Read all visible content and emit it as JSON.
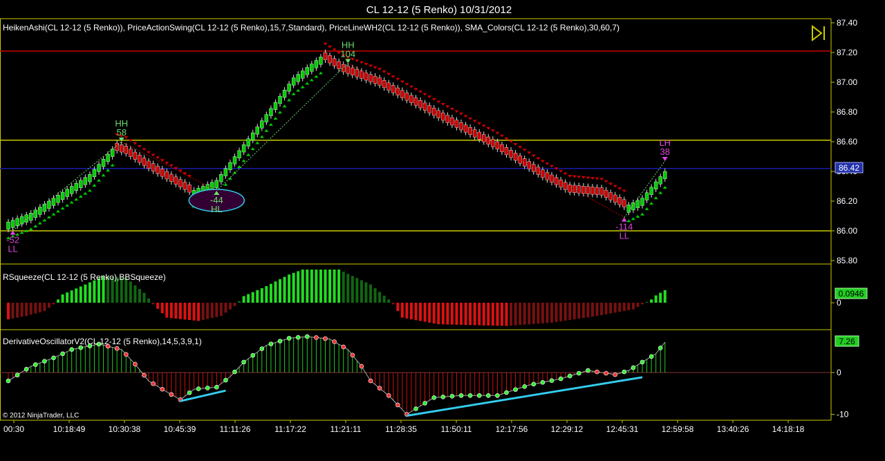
{
  "window_title": "CL 12-12 (5 Renko)  10/31/2012",
  "copyright": "© 2012 NinjaTrader, LLC",
  "colors": {
    "background": "#000000",
    "panel_border": "#cccc00",
    "bull": "#00cc00",
    "bear": "#cc0000",
    "swing_green": "#6fdc6f",
    "swing_magenta": "#dd44dd",
    "cyan": "#33ccee",
    "hline_red": "#cc0000",
    "hline_yellow": "#cccc00",
    "hline_blue": "#1a1aaa",
    "price_tag": "#2233aa",
    "value_tag": "#22cc22"
  },
  "chart_data": [
    {
      "type": "candlestick",
      "title": "HeikenAshi(CL 12-12 (5 Renko)), PriceActionSwing(CL 12-12 (5 Renko),15,7,Standard), PriceLineWH2(CL 12-12 (5 Renko)), SMA_Colors(CL 12-12 (5 Renko),30,60,7)",
      "y_ticks": [
        "87.40",
        "87.20",
        "87.00",
        "86.80",
        "86.60",
        "86.40",
        "86.20",
        "86.00",
        "85.80"
      ],
      "ylim": [
        85.8,
        87.4
      ],
      "last_price": "86.42",
      "horizontal_lines": [
        {
          "value": 87.21,
          "color": "red"
        },
        {
          "value": 86.61,
          "color": "yellow"
        },
        {
          "value": 86.42,
          "color": "blue"
        },
        {
          "value": 86.0,
          "color": "yellow"
        }
      ],
      "waypoints": [
        [
          0,
          86.06
        ],
        [
          5,
          86.12
        ],
        [
          10,
          86.22
        ],
        [
          18,
          86.38
        ],
        [
          23,
          86.55
        ],
        [
          26,
          86.52
        ],
        [
          31,
          86.42
        ],
        [
          40,
          86.26
        ],
        [
          46,
          86.34
        ],
        [
          55,
          86.7
        ],
        [
          63,
          87.03
        ],
        [
          69,
          87.17
        ],
        [
          74,
          87.07
        ],
        [
          82,
          86.98
        ],
        [
          95,
          86.76
        ],
        [
          108,
          86.55
        ],
        [
          118,
          86.36
        ],
        [
          124,
          86.26
        ],
        [
          131,
          86.24
        ],
        [
          136,
          86.16
        ],
        [
          140,
          86.22
        ],
        [
          143,
          86.33
        ],
        [
          145,
          86.4
        ]
      ],
      "swings": [
        {
          "bar": 1,
          "label": "LL",
          "value": "-52",
          "color": "magenta",
          "side": "below"
        },
        {
          "bar": 25,
          "label": "HH",
          "value": "58",
          "color": "green",
          "side": "above"
        },
        {
          "bar": 46,
          "label": "HL",
          "value": "-44",
          "color": "green",
          "side": "below",
          "highlight": true
        },
        {
          "bar": 75,
          "label": "HH",
          "value": "104",
          "color": "green",
          "side": "above"
        },
        {
          "bar": 136,
          "label": "LL",
          "value": "-114",
          "color": "magenta",
          "side": "below"
        },
        {
          "bar": 145,
          "label": "LH",
          "value": "38",
          "color": "magenta",
          "side": "above"
        }
      ]
    },
    {
      "type": "histogram",
      "title": "RSqueeze(CL 12-12 (5 Renko),BBSqueeze)",
      "y_ticks": [
        "0"
      ],
      "last_value": "0.0946",
      "waypoints": [
        [
          0,
          -0.5
        ],
        [
          4,
          -0.4
        ],
        [
          8,
          -0.25
        ],
        [
          10,
          -0.05
        ],
        [
          12,
          0.25
        ],
        [
          17,
          0.55
        ],
        [
          21,
          0.8
        ],
        [
          26,
          0.75
        ],
        [
          30,
          0.3
        ],
        [
          32,
          -0.05
        ],
        [
          35,
          -0.45
        ],
        [
          42,
          -0.55
        ],
        [
          47,
          -0.4
        ],
        [
          50,
          -0.1
        ],
        [
          52,
          0.2
        ],
        [
          57,
          0.5
        ],
        [
          62,
          0.85
        ],
        [
          65,
          1.0
        ],
        [
          73,
          1.0
        ],
        [
          80,
          0.55
        ],
        [
          84,
          0.1
        ],
        [
          85,
          -0.05
        ],
        [
          87,
          -0.45
        ],
        [
          95,
          -0.65
        ],
        [
          110,
          -0.7
        ],
        [
          120,
          -0.6
        ],
        [
          130,
          -0.4
        ],
        [
          138,
          -0.2
        ],
        [
          140,
          -0.05
        ],
        [
          142,
          0.1
        ],
        [
          143,
          0.22
        ],
        [
          145,
          0.38
        ]
      ]
    },
    {
      "type": "histogram_line",
      "title": "DerivativeOscillatorV2(CL 12-12 (5 Renko),14,5,3,9,1)",
      "y_ticks": [
        "0",
        "-10"
      ],
      "ylim": [
        -10,
        10
      ],
      "last_value": "7.26",
      "waypoints": [
        [
          0,
          -2.0
        ],
        [
          5,
          1.5
        ],
        [
          10,
          3.5
        ],
        [
          14,
          5.5
        ],
        [
          20,
          6.8
        ],
        [
          25,
          5.5
        ],
        [
          28,
          2.0
        ],
        [
          31,
          -2.0
        ],
        [
          34,
          -4.0
        ],
        [
          38,
          -6.5
        ],
        [
          41,
          -4.0
        ],
        [
          46,
          -3.5
        ],
        [
          49,
          -1.0
        ],
        [
          52,
          2.5
        ],
        [
          57,
          6.5
        ],
        [
          62,
          8.2
        ],
        [
          66,
          8.6
        ],
        [
          71,
          8.0
        ],
        [
          75,
          5.5
        ],
        [
          78,
          1.5
        ],
        [
          80,
          -2.0
        ],
        [
          84,
          -5.5
        ],
        [
          88,
          -10.0
        ],
        [
          94,
          -6.0
        ],
        [
          100,
          -5.5
        ],
        [
          108,
          -5.5
        ],
        [
          115,
          -3.0
        ],
        [
          122,
          -1.5
        ],
        [
          128,
          0.5
        ],
        [
          134,
          -0.5
        ],
        [
          137,
          0.5
        ],
        [
          143,
          4.5
        ],
        [
          145,
          7.26
        ]
      ],
      "trend_lines": [
        {
          "from": [
            38,
            -6.5
          ],
          "to": [
            48,
            -4.0
          ]
        },
        {
          "from": [
            88,
            -10.0
          ],
          "to": [
            140,
            -0.8
          ]
        }
      ]
    }
  ],
  "time_axis": {
    "labels": [
      "00:30",
      "10:18:49",
      "10:30:38",
      "10:45:39",
      "11:11:26",
      "11:17:22",
      "11:21:11",
      "11:28:35",
      "11:50:11",
      "12:17:56",
      "12:29:12",
      "12:45:31",
      "12:59:58",
      "13:40:26",
      "14:18:18"
    ]
  }
}
